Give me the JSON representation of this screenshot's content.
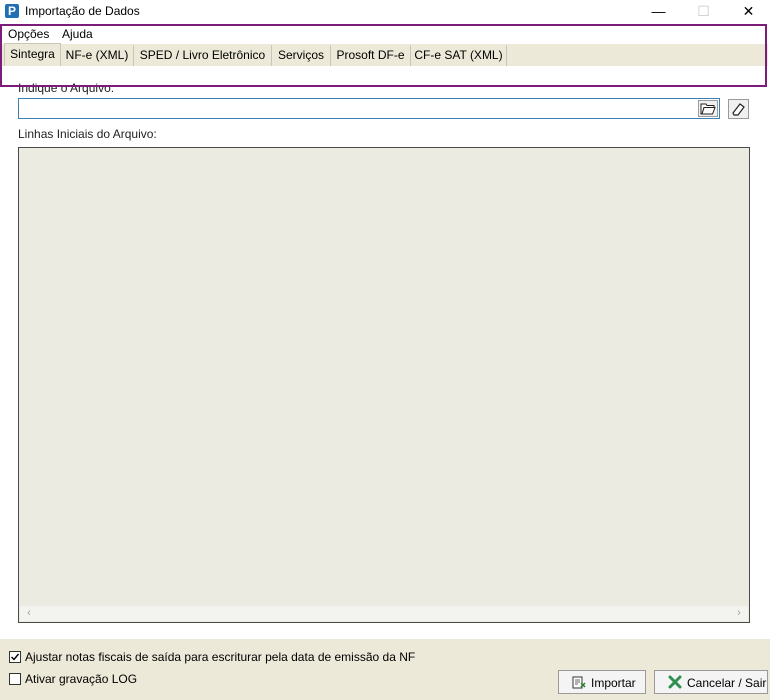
{
  "window": {
    "title": "Importação de Dados",
    "icon": "app-logo-icon",
    "app_letter": "P",
    "minimize_glyph": "—",
    "maximize_glyph": "☐",
    "close_glyph": "✕"
  },
  "menu": {
    "items": [
      "Opções",
      "Ajuda"
    ]
  },
  "tabs": [
    {
      "label": "Sintegra",
      "active": true
    },
    {
      "label": "NF-e (XML)",
      "active": false
    },
    {
      "label": "SPED / Livro Eletrônico",
      "active": false
    },
    {
      "label": "Serviços",
      "active": false
    },
    {
      "label": "Prosoft DF-e",
      "active": false
    },
    {
      "label": "CF-e SAT (XML)",
      "active": false
    }
  ],
  "file": {
    "label": "Indique o Arquivo:",
    "value": "",
    "open_icon": "folder-open-icon",
    "clear_icon": "eraser-icon"
  },
  "preview": {
    "label": "Linhas Iniciais do Arquivo:",
    "scroll_left": "‹",
    "scroll_right": "›"
  },
  "options": {
    "adjust_notes": {
      "label": "Ajustar notas fiscais de saída para escriturar pela data de emissão da NF",
      "checked": true
    },
    "log": {
      "label": "Ativar gravação LOG",
      "checked": false
    }
  },
  "buttons": {
    "import": "Importar",
    "cancel": "Cancelar / Sair"
  },
  "colors": {
    "highlight": "#7b1c7a",
    "panel": "#ece9d8",
    "input_border": "#3c7fb1"
  }
}
